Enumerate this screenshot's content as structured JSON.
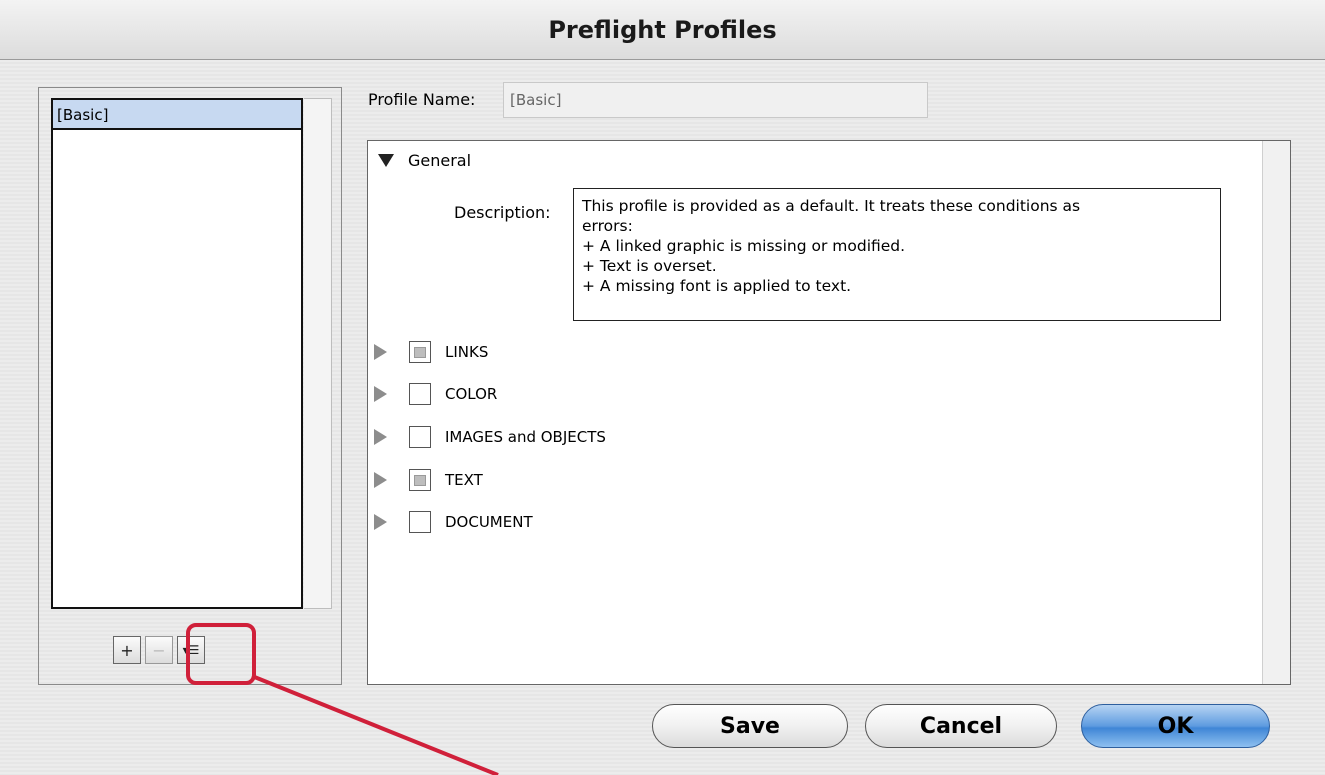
{
  "window": {
    "title": "Preflight Profiles"
  },
  "profile_list": {
    "items": [
      "[Basic]"
    ],
    "selected": "[Basic]",
    "buttons": {
      "add_icon": "plus-icon",
      "remove_icon": "minus-icon",
      "menu_icon": "list-menu-icon",
      "add_glyph": "+",
      "remove_glyph": "−",
      "menu_glyph": "▾☰"
    }
  },
  "profile_name": {
    "label": "Profile Name:",
    "value": "[Basic]"
  },
  "tree": {
    "general": {
      "label": "General",
      "expanded": true
    },
    "description": {
      "label": "Description:",
      "lines": [
        "This profile is provided as a default. It treats these conditions as",
        "errors:",
        "+ A linked graphic is missing or modified.",
        "+ Text is overset.",
        "+ A missing font is applied to text."
      ]
    },
    "categories": [
      {
        "label": "LINKS",
        "state": "mixed"
      },
      {
        "label": "COLOR",
        "state": "unchecked"
      },
      {
        "label": "IMAGES and OBJECTS",
        "state": "unchecked"
      },
      {
        "label": "TEXT",
        "state": "mixed"
      },
      {
        "label": "DOCUMENT",
        "state": "unchecked"
      }
    ]
  },
  "actions": {
    "save": "Save",
    "cancel": "Cancel",
    "ok": "OK"
  },
  "colors": {
    "callout": "#d0203a",
    "selection": "#c7d9f1",
    "default_button": "#5e9be0"
  }
}
